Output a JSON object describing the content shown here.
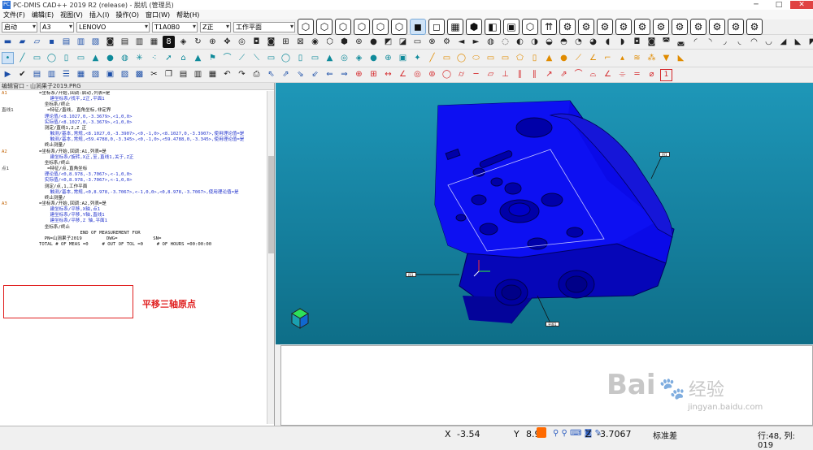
{
  "window": {
    "title": "PC-DMIS CAD++ 2019 R2 (release) - 脱机 (管理员)",
    "min": "─",
    "max": "□",
    "close": "✕"
  },
  "menu": [
    "文件(F)",
    "编辑(E)",
    "视图(V)",
    "插入(I)",
    "操作(O)",
    "窗口(W)",
    "帮助(H)"
  ],
  "toolbar1": {
    "combos": {
      "alignment": "启动",
      "probe": "A3",
      "probe_file": "LENOVO",
      "tip": "T1A0B0",
      "axis": "Z正",
      "workplane": "工作平面"
    }
  },
  "editor": {
    "title": "编辑窗口 - 山涧果子2019.PRG",
    "lines": [
      {
        "label": "A1",
        "label_style": "or",
        "text": "=坐标系/开始,回调:启动,列表=是"
      },
      {
        "label": "",
        "text": "    建坐标系/找平,Z正,平面1"
      },
      {
        "label": "",
        "text": "  坐标系/终止"
      },
      {
        "label": "直线1",
        "text": "   =特征/直线, 直角坐标,非定界"
      },
      {
        "label": "",
        "text": "  理论值/<8.1027,0,-3.3679>,<1,0,0>"
      },
      {
        "label": "",
        "text": "  实际值/<8.1027,0,-3.3679>,<1,0,0>"
      },
      {
        "label": "",
        "text": "  测定/直线1,2,Z 正"
      },
      {
        "label": "",
        "text": "    触测/基本,常规,<8.1027,0,-3.3907>,<0,-1,0>,<8.1027,0,-3.3907>,使用理论值=是"
      },
      {
        "label": "",
        "text": "    触测/基本,常规,<59.4788,0,-3.345>,<0,-1,0>,<59.4788,0,-3.345>,使用理论值=是"
      },
      {
        "label": "",
        "text": "  终止测量/"
      },
      {
        "label": "A2",
        "label_style": "or",
        "text": "=坐标系/开始,回调:A1,列表=是"
      },
      {
        "label": "",
        "text": "    建坐标系/旋转,X正,至,直线1,关于,Z正"
      },
      {
        "label": "",
        "text": "  坐标系/终止"
      },
      {
        "label": "点1",
        "text": "   =特征/点,直角坐标"
      },
      {
        "label": "",
        "text": "  理论值/<0,8.978,-3.7067>,<-1,0,0>"
      },
      {
        "label": "",
        "text": "  实际值/<0,8.978,-3.7067>,<-1,0,0>"
      },
      {
        "label": "",
        "text": "  测定/点,1,工作平面"
      },
      {
        "label": "",
        "text": "    触测/基本,常规,<0,8.978,-3.7067>,<-1,0,0>,<0,8.978,-3.7067>,使用理论值=是"
      },
      {
        "label": "",
        "text": "  终止测量/"
      },
      {
        "label": "A3",
        "label_style": "or",
        "text": "=坐标系/开始,回调:A2,列表=是"
      },
      {
        "label": "",
        "text": "    建坐标系/平移,X轴,点1"
      },
      {
        "label": "",
        "text": "    建坐标系/平移,Y轴,直线1"
      },
      {
        "label": "",
        "text": "    建坐标系/平移,Z 轴,平面1"
      },
      {
        "label": "",
        "text": "  坐标系/终止"
      },
      {
        "label": "",
        "text": "               END OF MEASUREMENT FOR"
      },
      {
        "label": "",
        "text": "  PN=山涧果子2019         DWG=             SN="
      },
      {
        "label": "",
        "text": "TOTAL # OF MEAS =0     # OUT OF TOL =0     # OF HOURS =00:00:00"
      }
    ]
  },
  "annotation": {
    "text": "平移三轴原点",
    "color": "#e02020"
  },
  "graphics": {
    "bg_top": "#1e97b8",
    "part_color": "#0a0ae8",
    "tags": [
      "回1",
      "回1",
      "平面1"
    ]
  },
  "statusbar": {
    "x_label": "X",
    "x_value": "-3.54",
    "y_label": "Y",
    "y_value": "8.9",
    "z_label": "Z",
    "z_value": "-3.7067",
    "mode": "标准差",
    "position": "行:48, 列: 019"
  },
  "watermark": {
    "brand": "Bai",
    "brand2": "百度",
    "cn": "经验",
    "url": "jingyan.baidu.com"
  }
}
